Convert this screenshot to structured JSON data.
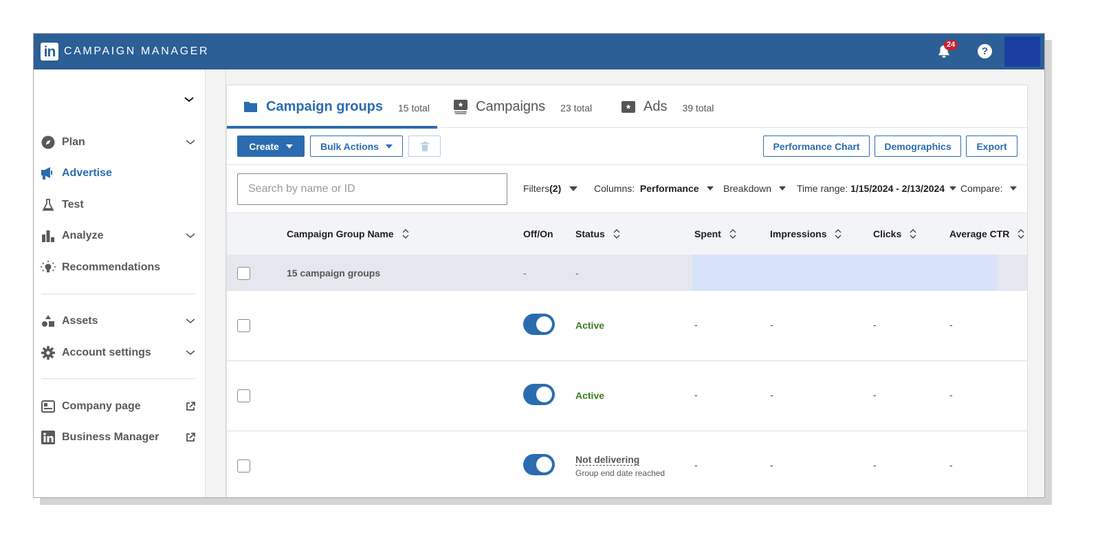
{
  "app": {
    "logo_text": "in",
    "title": "CAMPAIGN MANAGER",
    "notification_count": "24",
    "help_label": "?"
  },
  "sidebar": {
    "items": [
      {
        "label": "Plan",
        "icon": "compass-icon",
        "expandable": true
      },
      {
        "label": "Advertise",
        "icon": "megaphone-icon",
        "active": true
      },
      {
        "label": "Test",
        "icon": "flask-icon"
      },
      {
        "label": "Analyze",
        "icon": "bar-chart-icon",
        "expandable": true
      },
      {
        "label": "Recommendations",
        "icon": "lightbulb-icon"
      },
      {
        "label": "Assets",
        "icon": "shapes-icon",
        "expandable": true
      },
      {
        "label": "Account settings",
        "icon": "gear-icon",
        "expandable": true
      },
      {
        "label": "Company page",
        "icon": "company-page-icon",
        "external": true
      },
      {
        "label": "Business Manager",
        "icon": "linkedin-icon",
        "external": true
      }
    ]
  },
  "tabs": [
    {
      "label": "Campaign groups",
      "count": "15 total",
      "active": true
    },
    {
      "label": "Campaigns",
      "count": "23 total"
    },
    {
      "label": "Ads",
      "count": "39 total"
    }
  ],
  "toolbar": {
    "create_label": "Create",
    "bulk_actions_label": "Bulk Actions",
    "performance_chart_label": "Performance Chart",
    "demographics_label": "Demographics",
    "export_label": "Export"
  },
  "filters": {
    "search_placeholder": "Search by name or ID",
    "search_value": "",
    "filters_label": "Filters",
    "filters_count": "(2)",
    "columns_label": "Columns:",
    "columns_value": "Performance",
    "breakdown_label": "Breakdown",
    "time_range_label": "Time range:",
    "time_range_value": "1/15/2024 - 2/13/2024",
    "compare_label": "Compare:"
  },
  "table": {
    "columns": [
      "Campaign Group Name",
      "Off/On",
      "Status",
      "Spent",
      "Impressions",
      "Clicks",
      "Average CTR"
    ],
    "summary": {
      "name": "15 campaign groups",
      "offon": "-",
      "status": "-"
    },
    "rows": [
      {
        "name": "",
        "on": true,
        "status": "Active",
        "status_sub": "",
        "spent": "-",
        "impressions": "-",
        "clicks": "-",
        "ctr": "-"
      },
      {
        "name": "",
        "on": true,
        "status": "Active",
        "status_sub": "",
        "spent": "-",
        "impressions": "-",
        "clicks": "-",
        "ctr": "-"
      },
      {
        "name": "",
        "on": true,
        "status": "Not delivering",
        "status_sub": "Group end date reached",
        "spent": "-",
        "impressions": "-",
        "clicks": "-",
        "ctr": "-"
      }
    ]
  },
  "colors": {
    "brand": "#2b5f96",
    "accent": "#2b6cb0",
    "active_status": "#3a7d1f",
    "badge": "#cc1f2a"
  }
}
